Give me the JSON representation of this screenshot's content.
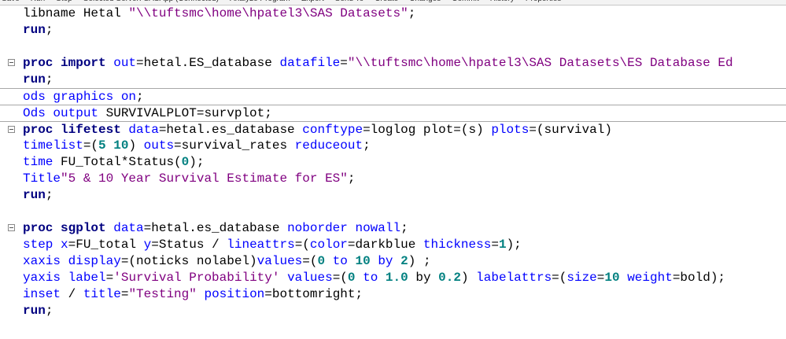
{
  "toolbar": {
    "items": [
      "Save",
      "Run",
      "Stop",
      "Selected Server: SASApp (Connected)",
      "Analyze Program",
      "Export",
      "Send To",
      "Create",
      "Changes",
      "Commit",
      "History",
      "Properties"
    ]
  },
  "code_lines": [
    {
      "tokens": [
        {
          "t": "libname Hetal ",
          "c": "plain"
        },
        {
          "t": "\"\\\\tuftsmc\\home\\hpatel3\\SAS Datasets\"",
          "c": "str"
        },
        {
          "t": ";",
          "c": "plain"
        }
      ]
    },
    {
      "tokens": [
        {
          "t": "run",
          "c": "kw"
        },
        {
          "t": ";",
          "c": "plain"
        }
      ]
    },
    {
      "tokens": []
    },
    {
      "fold": true,
      "indent": 0,
      "tokens": [
        {
          "t": "proc import ",
          "c": "kw"
        },
        {
          "t": "out",
          "c": "opt"
        },
        {
          "t": "=hetal.ES_database ",
          "c": "plain"
        },
        {
          "t": "datafile",
          "c": "opt"
        },
        {
          "t": "=",
          "c": "plain"
        },
        {
          "t": "\"\\\\tuftsmc\\home\\hpatel3\\SAS Datasets\\ES Database Ed",
          "c": "str"
        }
      ]
    },
    {
      "tokens": [
        {
          "t": "run",
          "c": "kw"
        },
        {
          "t": ";",
          "c": "plain"
        }
      ]
    },
    {
      "sep": true,
      "tokens": [
        {
          "t": "ods graphics on",
          "c": "opt"
        },
        {
          "t": ";",
          "c": "plain"
        }
      ]
    },
    {
      "sep": true,
      "tokens": [
        {
          "t": "Ods output ",
          "c": "opt"
        },
        {
          "t": "SURVIVALPLOT=survplot;",
          "c": "plain"
        }
      ]
    },
    {
      "sep": true,
      "fold": true,
      "indent": 0,
      "tokens": [
        {
          "t": "proc lifetest ",
          "c": "kw"
        },
        {
          "t": "data",
          "c": "opt"
        },
        {
          "t": "=hetal.es_database ",
          "c": "plain"
        },
        {
          "t": "conftype",
          "c": "opt"
        },
        {
          "t": "=loglog plot=(s) ",
          "c": "plain"
        },
        {
          "t": "plots",
          "c": "opt"
        },
        {
          "t": "=(survival)",
          "c": "plain"
        }
      ]
    },
    {
      "tokens": [
        {
          "t": "timelist",
          "c": "opt"
        },
        {
          "t": "=(",
          "c": "plain"
        },
        {
          "t": "5",
          "c": "num"
        },
        {
          "t": " ",
          "c": "plain"
        },
        {
          "t": "10",
          "c": "num"
        },
        {
          "t": ") ",
          "c": "plain"
        },
        {
          "t": "outs",
          "c": "opt"
        },
        {
          "t": "=survival_rates ",
          "c": "plain"
        },
        {
          "t": "reduceout",
          "c": "opt"
        },
        {
          "t": ";",
          "c": "plain"
        }
      ]
    },
    {
      "tokens": [
        {
          "t": "time ",
          "c": "opt"
        },
        {
          "t": "FU_Total*Status(",
          "c": "plain"
        },
        {
          "t": "0",
          "c": "num"
        },
        {
          "t": ");",
          "c": "plain"
        }
      ]
    },
    {
      "tokens": [
        {
          "t": "Title",
          "c": "opt"
        },
        {
          "t": "\"5 & 10 Year Survival Estimate for ES\"",
          "c": "str"
        },
        {
          "t": ";",
          "c": "plain"
        }
      ]
    },
    {
      "tokens": [
        {
          "t": "run",
          "c": "kw"
        },
        {
          "t": ";",
          "c": "plain"
        }
      ]
    },
    {
      "tokens": []
    },
    {
      "fold": true,
      "indent": 0,
      "tokens": [
        {
          "t": "proc sgplot ",
          "c": "kw"
        },
        {
          "t": "data",
          "c": "opt"
        },
        {
          "t": "=hetal.es_database ",
          "c": "plain"
        },
        {
          "t": "noborder nowall",
          "c": "opt"
        },
        {
          "t": ";",
          "c": "plain"
        }
      ]
    },
    {
      "tokens": [
        {
          "t": "step ",
          "c": "opt"
        },
        {
          "t": "x",
          "c": "opt"
        },
        {
          "t": "=FU_total ",
          "c": "plain"
        },
        {
          "t": "y",
          "c": "opt"
        },
        {
          "t": "=Status / ",
          "c": "plain"
        },
        {
          "t": "lineattrs",
          "c": "opt"
        },
        {
          "t": "=(",
          "c": "plain"
        },
        {
          "t": "color",
          "c": "opt"
        },
        {
          "t": "=darkblue ",
          "c": "plain"
        },
        {
          "t": "thickness",
          "c": "opt"
        },
        {
          "t": "=",
          "c": "plain"
        },
        {
          "t": "1",
          "c": "num"
        },
        {
          "t": ");",
          "c": "plain"
        }
      ]
    },
    {
      "tokens": [
        {
          "t": "xaxis ",
          "c": "opt"
        },
        {
          "t": "display",
          "c": "opt"
        },
        {
          "t": "=(noticks nolabel)",
          "c": "plain"
        },
        {
          "t": "values",
          "c": "opt"
        },
        {
          "t": "=(",
          "c": "plain"
        },
        {
          "t": "0",
          "c": "num"
        },
        {
          "t": " ",
          "c": "plain"
        },
        {
          "t": "to",
          "c": "opt"
        },
        {
          "t": " ",
          "c": "plain"
        },
        {
          "t": "10",
          "c": "num"
        },
        {
          "t": " ",
          "c": "plain"
        },
        {
          "t": "by",
          "c": "opt"
        },
        {
          "t": " ",
          "c": "plain"
        },
        {
          "t": "2",
          "c": "num"
        },
        {
          "t": ") ;",
          "c": "plain"
        }
      ]
    },
    {
      "tokens": [
        {
          "t": "yaxis ",
          "c": "opt"
        },
        {
          "t": "label",
          "c": "opt"
        },
        {
          "t": "=",
          "c": "plain"
        },
        {
          "t": "'Survival Probability'",
          "c": "str"
        },
        {
          "t": " ",
          "c": "plain"
        },
        {
          "t": "values",
          "c": "opt"
        },
        {
          "t": "=(",
          "c": "plain"
        },
        {
          "t": "0",
          "c": "num"
        },
        {
          "t": " ",
          "c": "plain"
        },
        {
          "t": "to",
          "c": "opt"
        },
        {
          "t": " ",
          "c": "plain"
        },
        {
          "t": "1.0",
          "c": "num"
        },
        {
          "t": " by ",
          "c": "plain"
        },
        {
          "t": "0.2",
          "c": "num"
        },
        {
          "t": ") ",
          "c": "plain"
        },
        {
          "t": "labelattrs",
          "c": "opt"
        },
        {
          "t": "=(",
          "c": "plain"
        },
        {
          "t": "size",
          "c": "opt"
        },
        {
          "t": "=",
          "c": "plain"
        },
        {
          "t": "10",
          "c": "num"
        },
        {
          "t": " ",
          "c": "plain"
        },
        {
          "t": "weight",
          "c": "opt"
        },
        {
          "t": "=bold);",
          "c": "plain"
        }
      ]
    },
    {
      "tokens": [
        {
          "t": "inset ",
          "c": "opt"
        },
        {
          "t": "/ ",
          "c": "plain"
        },
        {
          "t": "title",
          "c": "opt"
        },
        {
          "t": "=",
          "c": "plain"
        },
        {
          "t": "\"Testing\"",
          "c": "str"
        },
        {
          "t": " ",
          "c": "plain"
        },
        {
          "t": "position",
          "c": "opt"
        },
        {
          "t": "=bottomright;",
          "c": "plain"
        }
      ]
    },
    {
      "tokens": [
        {
          "t": "run",
          "c": "kw"
        },
        {
          "t": ";",
          "c": "plain"
        }
      ]
    }
  ]
}
